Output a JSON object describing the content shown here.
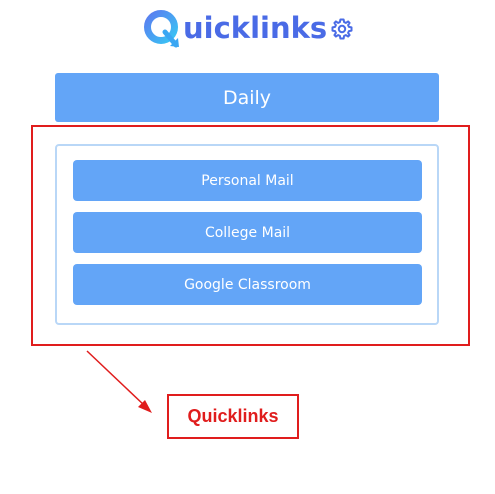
{
  "header": {
    "logo_text": "uicklinks",
    "logo_icon": "q-logo-icon",
    "settings_icon": "gear-icon"
  },
  "daily_button": {
    "label": "Daily"
  },
  "links": [
    {
      "label": "Personal Mail"
    },
    {
      "label": "College Mail"
    },
    {
      "label": "Google Classroom"
    }
  ],
  "annotation": {
    "callout_label": "Quicklinks",
    "color": "#e01d1d"
  },
  "colors": {
    "brand": "#4a6be6",
    "button": "#63a5f7",
    "panel_border": "#b9d7f7"
  }
}
